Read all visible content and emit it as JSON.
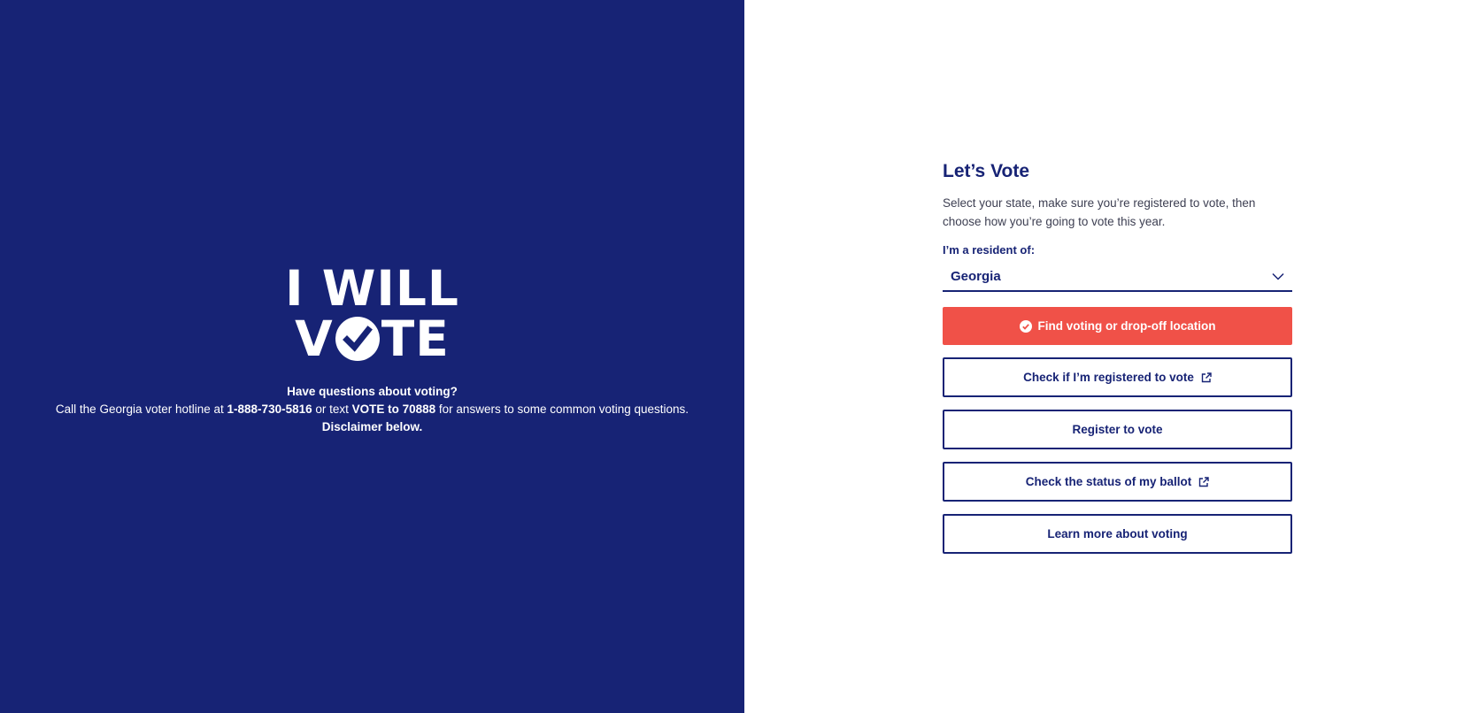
{
  "colors": {
    "navy": "#172375",
    "coral": "#f05148",
    "white": "#ffffff"
  },
  "left": {
    "logo": {
      "line1": "I WILL",
      "line2_prefix": "V",
      "line2_suffix": "TE"
    },
    "hotline": {
      "heading": "Have questions about voting?",
      "text_1": "Call the Georgia voter hotline at ",
      "phone": "1-888-730-5816",
      "text_2": " or text ",
      "sms": "VOTE to 70888",
      "text_3": " for answers to some common voting questions.",
      "disclaimer": "Disclaimer below."
    }
  },
  "form": {
    "title": "Let’s Vote",
    "description": "Select your state, make sure you’re registered to vote, then choose how you’re going to vote this year.",
    "resident_label": "I’m a resident of:",
    "state_value": "Georgia",
    "state_icon": "chevron-down-icon",
    "buttons": {
      "find_location": {
        "label": "Find voting or drop-off location",
        "icon": "check-circle-icon"
      },
      "check_registered": {
        "label": "Check if I’m registered to vote",
        "icon": "external-link-icon"
      },
      "register": {
        "label": "Register to vote"
      },
      "ballot_status": {
        "label": "Check the status of my ballot",
        "icon": "external-link-icon"
      },
      "learn_more": {
        "label": "Learn more about voting"
      }
    }
  }
}
